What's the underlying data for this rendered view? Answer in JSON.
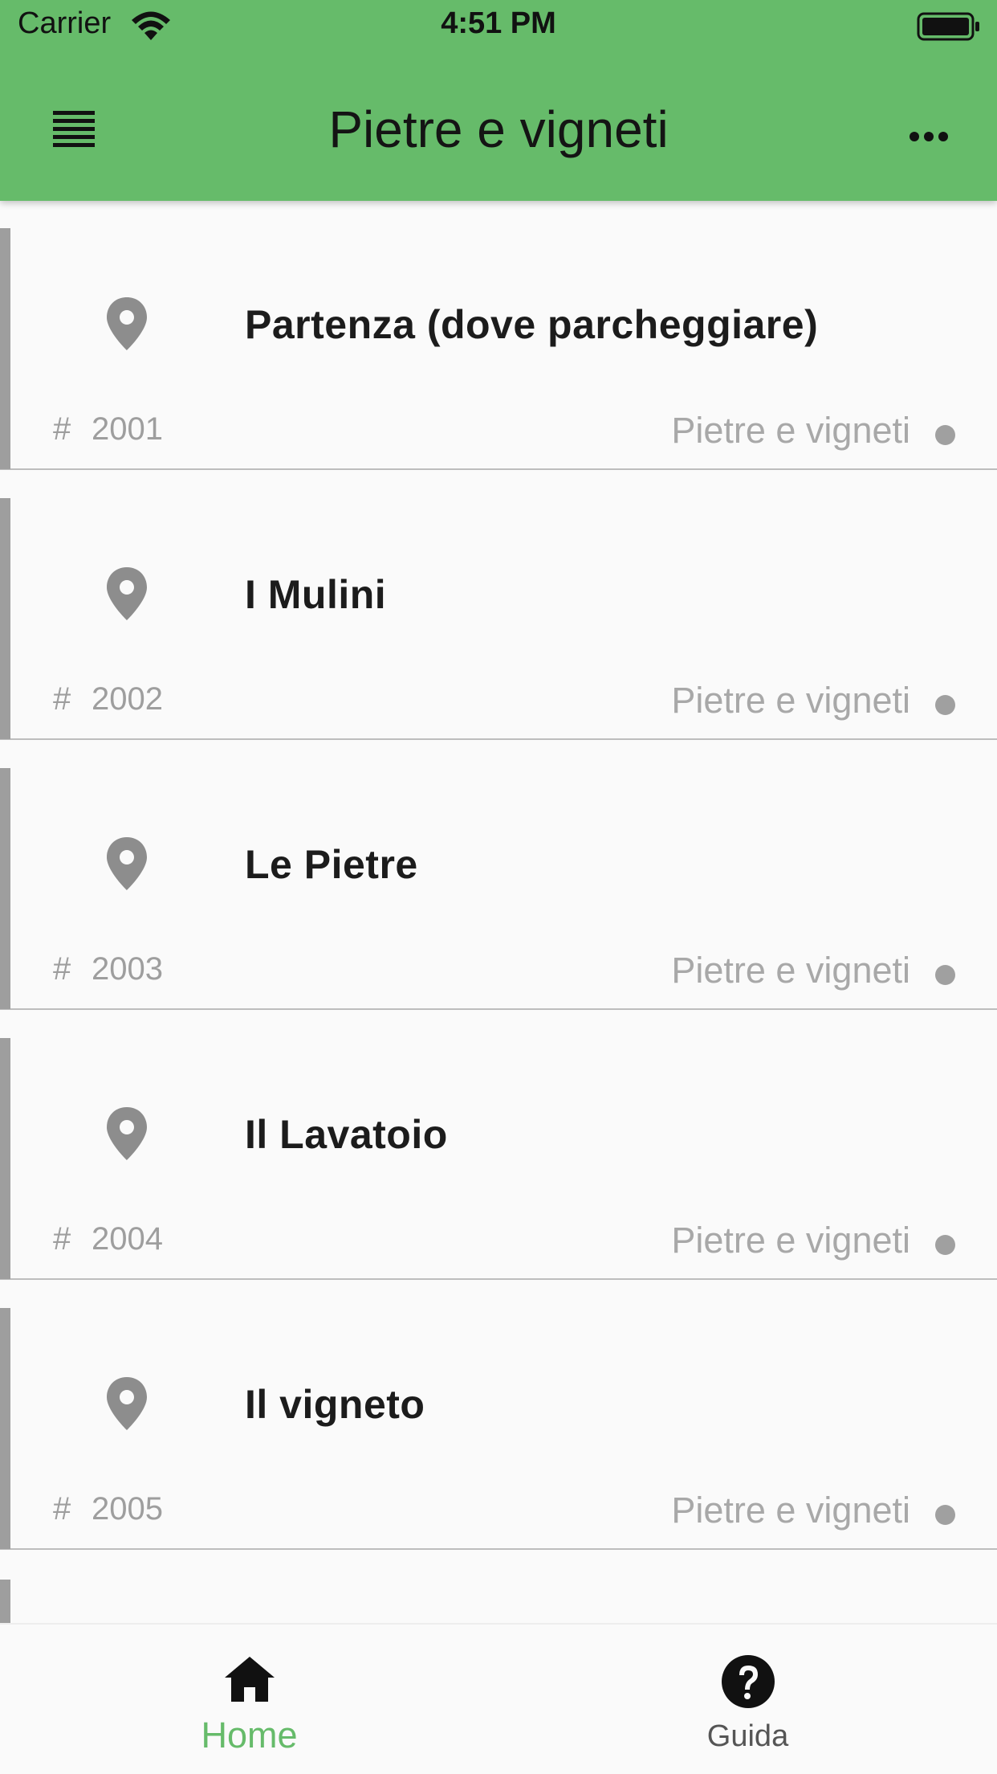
{
  "status_bar": {
    "carrier": "Carrier",
    "time": "4:51 PM",
    "wifi_icon": "wifi-icon",
    "battery_icon": "battery-full-icon"
  },
  "app_bar": {
    "title": "Pietre e vigneti",
    "menu_icon": "list-menu-icon",
    "more_icon": "more-horizontal-icon",
    "color": "#66bb6a"
  },
  "list": {
    "items": [
      {
        "name": "Partenza (dove parcheggiare)",
        "hash": "#",
        "code": "2001",
        "route": "Pietre e vigneti"
      },
      {
        "name": "I Mulini",
        "hash": "#",
        "code": "2002",
        "route": "Pietre e vigneti"
      },
      {
        "name": "Le Pietre",
        "hash": "#",
        "code": "2003",
        "route": "Pietre e vigneti"
      },
      {
        "name": "Il Lavatoio",
        "hash": "#",
        "code": "2004",
        "route": "Pietre e vigneti"
      },
      {
        "name": "Il vigneto",
        "hash": "#",
        "code": "2005",
        "route": "Pietre e vigneti"
      }
    ],
    "item_icon": "map-pin-icon"
  },
  "bottom_nav": {
    "tabs": [
      {
        "label": "Home",
        "icon": "home-icon",
        "active": true
      },
      {
        "label": "Guida",
        "icon": "help-circle-icon",
        "active": false
      }
    ],
    "active_color": "#66bb6a"
  }
}
